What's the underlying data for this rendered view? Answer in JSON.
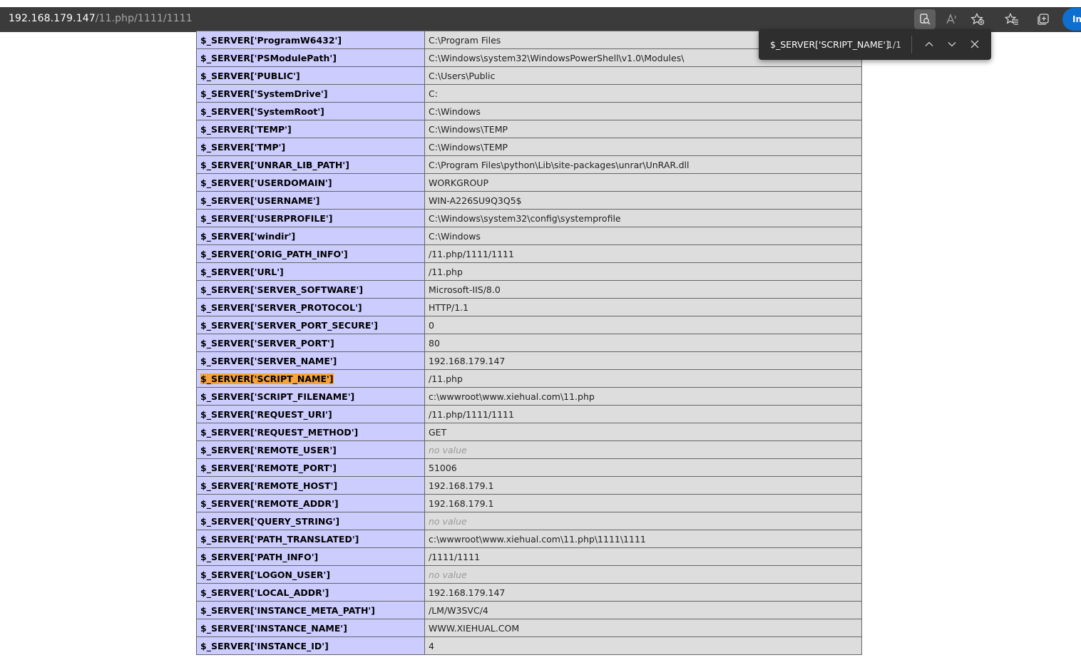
{
  "browser": {
    "address_host": "192.168.179.147",
    "address_path": "/11.php/1111/1111",
    "profile_label": "In",
    "icons": [
      "app-icon",
      "read-aloud-icon",
      "add-favorite-icon",
      "favorites-icon",
      "collections-icon"
    ],
    "accent_color": "#0e6fd0"
  },
  "find_bar": {
    "query": "$_SERVER['SCRIPT_NAME']",
    "count": "1/1",
    "icons": [
      "chevron-up-icon",
      "chevron-down-icon",
      "close-icon"
    ]
  },
  "table": {
    "key_bg": "#ccccff",
    "value_bg": "#dddddd",
    "highlight_color": "#f7a23a",
    "rows": [
      {
        "key": "$_SERVER['ProgramW6432']",
        "value": "C:\\Program Files"
      },
      {
        "key": "$_SERVER['PSModulePath']",
        "value": "C:\\Windows\\system32\\WindowsPowerShell\\v1.0\\Modules\\"
      },
      {
        "key": "$_SERVER['PUBLIC']",
        "value": "C:\\Users\\Public"
      },
      {
        "key": "$_SERVER['SystemDrive']",
        "value": "C:"
      },
      {
        "key": "$_SERVER['SystemRoot']",
        "value": "C:\\Windows"
      },
      {
        "key": "$_SERVER['TEMP']",
        "value": "C:\\Windows\\TEMP"
      },
      {
        "key": "$_SERVER['TMP']",
        "value": "C:\\Windows\\TEMP"
      },
      {
        "key": "$_SERVER['UNRAR_LIB_PATH']",
        "value": "C:\\Program Files\\python\\Lib\\site-packages\\unrar\\UnRAR.dll"
      },
      {
        "key": "$_SERVER['USERDOMAIN']",
        "value": "WORKGROUP"
      },
      {
        "key": "$_SERVER['USERNAME']",
        "value": "WIN-A226SU9Q3Q5$"
      },
      {
        "key": "$_SERVER['USERPROFILE']",
        "value": "C:\\Windows\\system32\\config\\systemprofile"
      },
      {
        "key": "$_SERVER['windir']",
        "value": "C:\\Windows"
      },
      {
        "key": "$_SERVER['ORIG_PATH_INFO']",
        "value": "/11.php/1111/1111"
      },
      {
        "key": "$_SERVER['URL']",
        "value": "/11.php"
      },
      {
        "key": "$_SERVER['SERVER_SOFTWARE']",
        "value": "Microsoft-IIS/8.0"
      },
      {
        "key": "$_SERVER['SERVER_PROTOCOL']",
        "value": "HTTP/1.1"
      },
      {
        "key": "$_SERVER['SERVER_PORT_SECURE']",
        "value": "0"
      },
      {
        "key": "$_SERVER['SERVER_PORT']",
        "value": "80"
      },
      {
        "key": "$_SERVER['SERVER_NAME']",
        "value": "192.168.179.147"
      },
      {
        "key": "$_SERVER['SCRIPT_NAME']",
        "value": "/11.php",
        "highlighted": true
      },
      {
        "key": "$_SERVER['SCRIPT_FILENAME']",
        "value": "c:\\wwwroot\\www.xiehual.com\\11.php"
      },
      {
        "key": "$_SERVER['REQUEST_URI']",
        "value": "/11.php/1111/1111"
      },
      {
        "key": "$_SERVER['REQUEST_METHOD']",
        "value": "GET"
      },
      {
        "key": "$_SERVER['REMOTE_USER']",
        "value": "no value",
        "no_value": true
      },
      {
        "key": "$_SERVER['REMOTE_PORT']",
        "value": "51006"
      },
      {
        "key": "$_SERVER['REMOTE_HOST']",
        "value": "192.168.179.1"
      },
      {
        "key": "$_SERVER['REMOTE_ADDR']",
        "value": "192.168.179.1"
      },
      {
        "key": "$_SERVER['QUERY_STRING']",
        "value": "no value",
        "no_value": true
      },
      {
        "key": "$_SERVER['PATH_TRANSLATED']",
        "value": "c:\\wwwroot\\www.xiehual.com\\11.php\\1111\\1111"
      },
      {
        "key": "$_SERVER['PATH_INFO']",
        "value": "/1111/1111"
      },
      {
        "key": "$_SERVER['LOGON_USER']",
        "value": "no value",
        "no_value": true
      },
      {
        "key": "$_SERVER['LOCAL_ADDR']",
        "value": "192.168.179.147"
      },
      {
        "key": "$_SERVER['INSTANCE_META_PATH']",
        "value": "/LM/W3SVC/4"
      },
      {
        "key": "$_SERVER['INSTANCE_NAME']",
        "value": "WWW.XIEHUAL.COM"
      },
      {
        "key": "$_SERVER['INSTANCE_ID']",
        "value": "4"
      }
    ]
  }
}
